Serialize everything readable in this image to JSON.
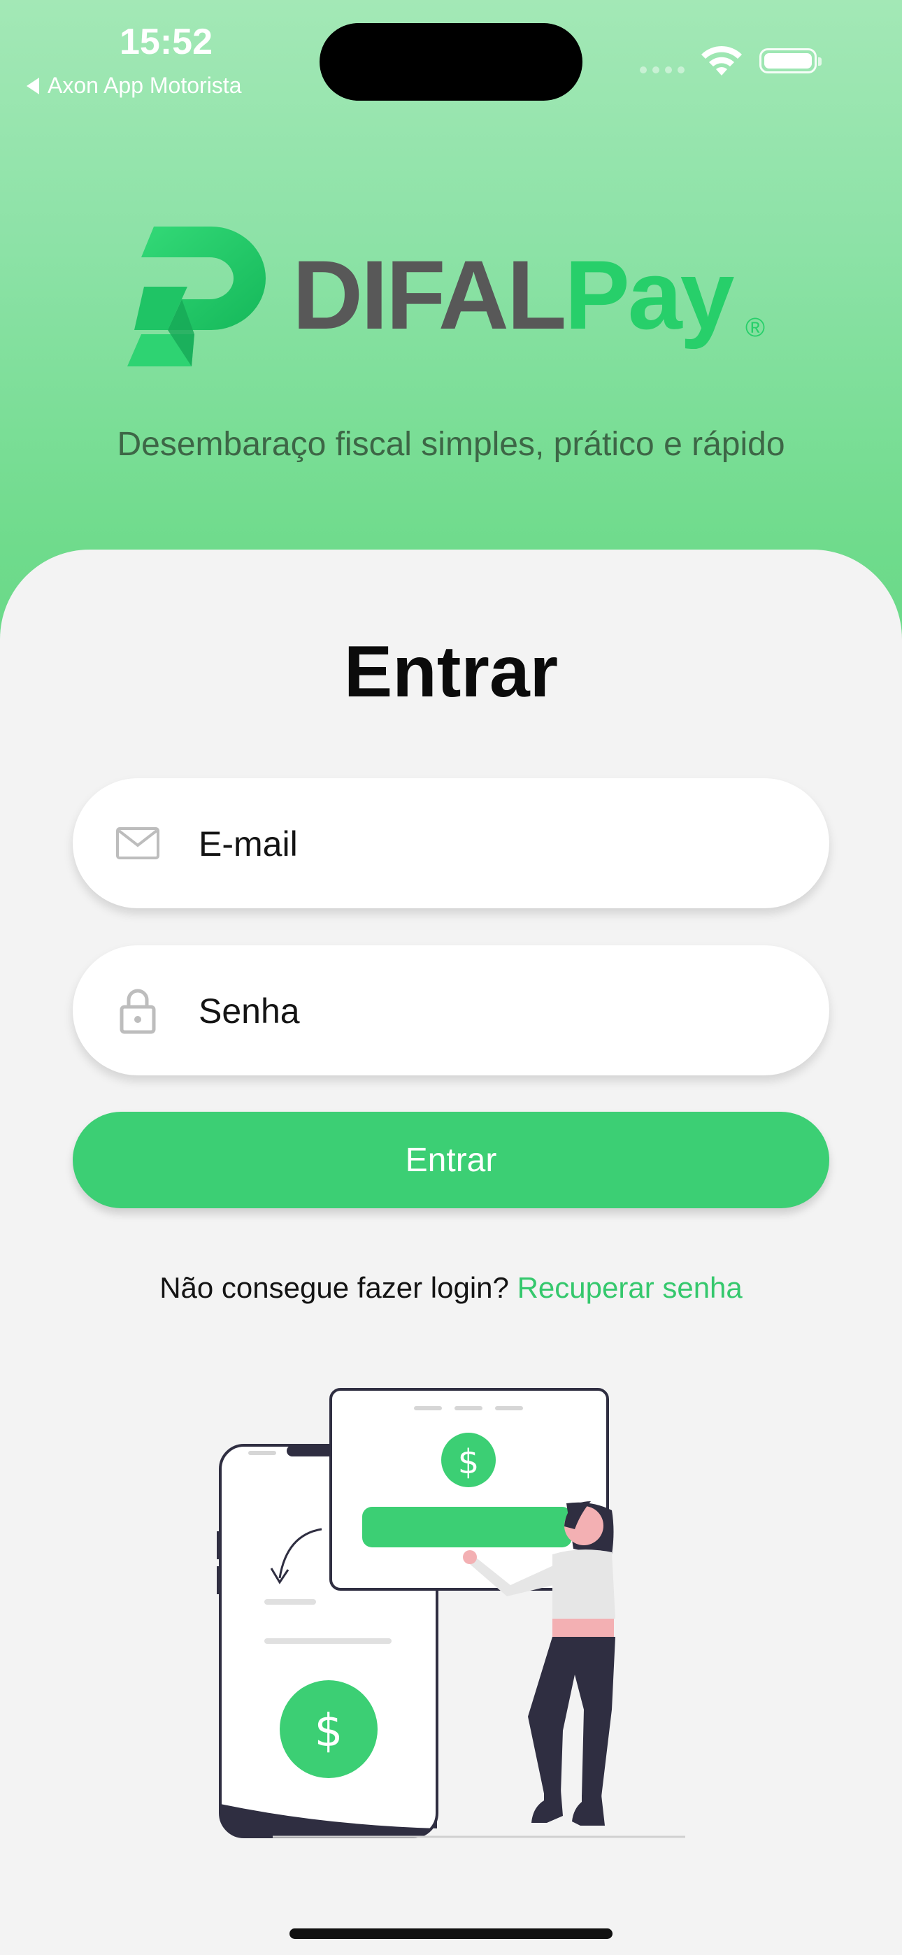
{
  "status_bar": {
    "time": "15:52",
    "back_label": "Axon App Motorista"
  },
  "brand": {
    "name_part1": "DIFAL",
    "name_part2": "Pay",
    "registered": "®",
    "tagline": "Desembaraço fiscal simples, prático e rápido"
  },
  "login": {
    "title": "Entrar",
    "email_placeholder": "E-mail",
    "password_placeholder": "Senha",
    "submit_label": "Entrar",
    "recover_prompt": "Não consegue fazer login?",
    "recover_link": "Recuperar senha"
  },
  "icons": [
    "wifi-icon",
    "battery-icon",
    "mail-icon",
    "lock-icon",
    "dollar-icon"
  ],
  "colors": {
    "accent": "#3ccf74",
    "brand_green": "#27cf6a",
    "brand_gray": "#585858",
    "header_gradient_top": "#a3e8b6",
    "header_gradient_bottom": "#68d987"
  }
}
